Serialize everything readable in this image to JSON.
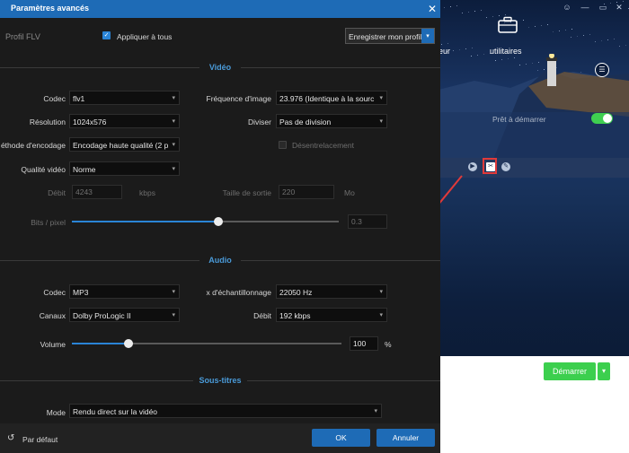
{
  "background_app": {
    "nav_partial_label": "eur",
    "nav_utilities_label": "utilitaires",
    "ready_label": "Prêt à démarrer",
    "start_button_label": "Démarrer"
  },
  "dialog": {
    "title": "Paramètres avancés",
    "profile_label": "Profil  FLV",
    "apply_all_label": "Appliquer à tous",
    "save_profile_label": "Enregistrer mon profil",
    "video": {
      "section_title": "Vidéo",
      "codec_label": "Codec",
      "codec_value": "flv1",
      "framerate_label": "Fréquence d'image",
      "framerate_value": "23.976 (Identique à la sourc",
      "resolution_label": "Résolution",
      "resolution_value": "1024x576",
      "split_label": "Diviser",
      "split_value": "Pas de division",
      "encoding_label": "éthode d'encodage",
      "encoding_value": "Encodage haute qualité (2 p",
      "deinterlace_label": "Désentrelacement",
      "quality_label": "Qualité vidéo",
      "quality_value": "Norme",
      "bitrate_label": "Débit",
      "bitrate_value": "4243",
      "bitrate_unit": "kbps",
      "output_size_label": "Taille de sortie",
      "output_size_value": "220",
      "output_size_unit": "Mo",
      "bits_pixel_label": "Bits / pixel",
      "bits_pixel_value": "0.3",
      "bits_pixel_slider_fraction": 0.55
    },
    "audio": {
      "section_title": "Audio",
      "codec_label": "Codec",
      "codec_value": "MP3",
      "sample_rate_label": "x d'échantillonnage",
      "sample_rate_value": "22050 Hz",
      "channels_label": "Canaux",
      "channels_value": "Dolby ProLogic II",
      "bitrate_label": "Débit",
      "bitrate_value": "192 kbps",
      "volume_label": "Volume",
      "volume_value": "100",
      "volume_unit": "%",
      "volume_slider_fraction": 0.21
    },
    "subtitles": {
      "section_title": "Sous-titres",
      "mode_label": "Mode",
      "mode_value": "Rendu direct sur la vidéo"
    },
    "footer": {
      "default_label": "Par défaut",
      "ok_label": "OK",
      "cancel_label": "Annuler"
    }
  },
  "colors": {
    "accent": "#1e6bb6",
    "section_title": "#4a9ad8",
    "start_green": "#3ccf4e",
    "highlight_red": "#e03a3a"
  }
}
